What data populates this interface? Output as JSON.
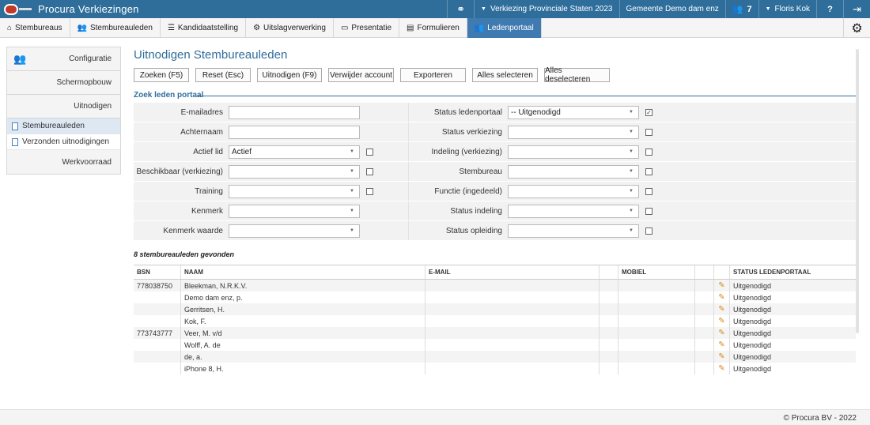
{
  "app": {
    "title": "Procura Verkiezingen"
  },
  "topbar": {
    "election": "Verkiezing Provinciale Staten 2023",
    "municipality": "Gemeente Demo dam enz",
    "member_count": "7",
    "user": "Floris Kok",
    "help": "?"
  },
  "nav": {
    "tabs": [
      {
        "label": "Stembureaus"
      },
      {
        "label": "Stembureauleden"
      },
      {
        "label": "Kandidaatstelling"
      },
      {
        "label": "Uitslagverwerking"
      },
      {
        "label": "Presentatie"
      },
      {
        "label": "Formulieren"
      },
      {
        "label": "Ledenportaal"
      }
    ],
    "active": "Ledenportaal"
  },
  "sidebar": {
    "groups": [
      {
        "label": "Configuratie"
      },
      {
        "label": "Schermopbouw"
      },
      {
        "label": "Uitnodigen"
      },
      {
        "label": "Werkvoorraad"
      }
    ],
    "subitems": [
      {
        "label": "Stembureauleden"
      },
      {
        "label": "Verzonden uitnodigingen"
      }
    ]
  },
  "page": {
    "title": "Uitnodigen Stembureauleden"
  },
  "toolbar": {
    "search": "Zoeken (F5)",
    "reset": "Reset (Esc)",
    "invite": "Uitnodigen (F9)",
    "delete_account": "Verwijder account",
    "export": "Exporteren",
    "select_all": "Alles selecteren",
    "deselect_all": "Alles deselecteren"
  },
  "search": {
    "title": "Zoek leden portaal",
    "left": [
      {
        "label": "E-mailadres",
        "value": ""
      },
      {
        "label": "Achternaam",
        "value": ""
      },
      {
        "label": "Actief lid",
        "value": "Actief"
      },
      {
        "label": "Beschikbaar (verkiezing)",
        "value": ""
      },
      {
        "label": "Training",
        "value": ""
      },
      {
        "label": "Kenmerk",
        "value": ""
      },
      {
        "label": "Kenmerk waarde",
        "value": ""
      }
    ],
    "right": [
      {
        "label": "Status ledenportaal",
        "value": "-- Uitgenodigd"
      },
      {
        "label": "Status verkiezing",
        "value": ""
      },
      {
        "label": "Indeling (verkiezing)",
        "value": ""
      },
      {
        "label": "Stembureau",
        "value": ""
      },
      {
        "label": "Functie (ingedeeld)",
        "value": ""
      },
      {
        "label": "Status indeling",
        "value": ""
      },
      {
        "label": "Status opleiding",
        "value": ""
      }
    ]
  },
  "results": {
    "count_text": "8 stembureauleden gevonden",
    "headers": {
      "bsn": "BSN",
      "naam": "NAAM",
      "email": "E-MAIL",
      "mobiel": "MOBIEL",
      "status": "STATUS LEDENPORTAAL"
    },
    "rows": [
      {
        "bsn": "778038750",
        "naam": "Bleekman, N.R.K.V.",
        "status": "Uitgenodigd"
      },
      {
        "bsn": "",
        "naam": "Demo dam enz, p.",
        "status": "Uitgenodigd"
      },
      {
        "bsn": "",
        "naam": "Gerritsen, H.",
        "status": "Uitgenodigd"
      },
      {
        "bsn": "",
        "naam": "Kok, F.",
        "status": "Uitgenodigd"
      },
      {
        "bsn": "773743777",
        "naam": "Veer, M. v/d",
        "status": "Uitgenodigd"
      },
      {
        "bsn": "",
        "naam": "Wolff, A. de",
        "status": "Uitgenodigd"
      },
      {
        "bsn": "",
        "naam": "de, a.",
        "status": "Uitgenodigd"
      },
      {
        "bsn": "",
        "naam": "iPhone 8, H.",
        "status": "Uitgenodigd"
      }
    ]
  },
  "footer": {
    "text": "© Procura BV - 2022"
  }
}
